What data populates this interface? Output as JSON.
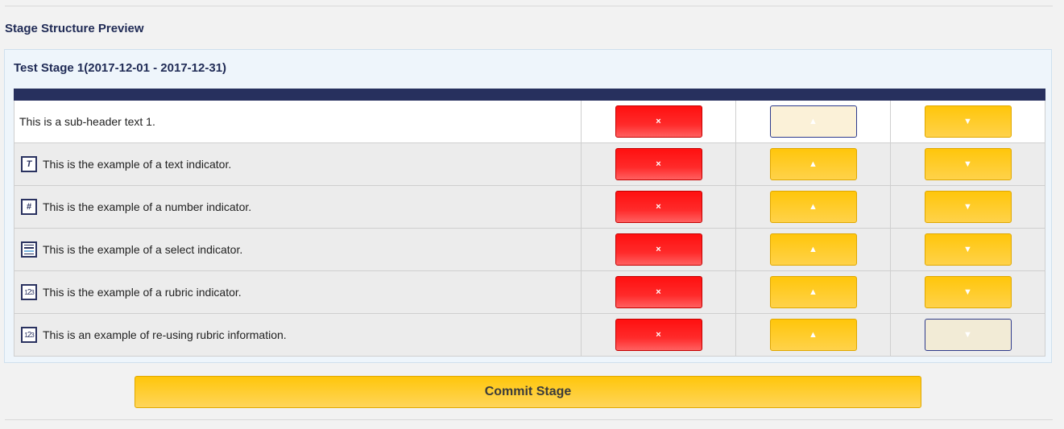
{
  "section_title": "Stage Structure Preview",
  "stage": {
    "title": "Test Stage 1(2017-12-01 - 2017-12-31)"
  },
  "rows": [
    {
      "label": "This is a sub-header text 1.",
      "type": "subheader",
      "icon": null,
      "up_disabled": true,
      "down_disabled": false
    },
    {
      "label": "This is the example of a text indicator.",
      "type": "text",
      "icon": "T",
      "up_disabled": false,
      "down_disabled": false
    },
    {
      "label": "This is the example of a number indicator.",
      "type": "number",
      "icon": "#",
      "up_disabled": false,
      "down_disabled": false
    },
    {
      "label": "This is the example of a select indicator.",
      "type": "select",
      "icon": "select-list-icon",
      "up_disabled": false,
      "down_disabled": false
    },
    {
      "label": "This is the example of a rubric indicator.",
      "type": "rubric",
      "icon": "123",
      "up_disabled": false,
      "down_disabled": false
    },
    {
      "label": "This is an example of re-using rubric information.",
      "type": "rubric",
      "icon": "123",
      "up_disabled": false,
      "down_disabled": true
    }
  ],
  "buttons": {
    "remove_glyph": "×",
    "up_glyph": "▲",
    "down_glyph": "▼",
    "commit_label": "Commit Stage"
  },
  "colors": {
    "header_navy": "#27305e",
    "remove_red": "#ff1a1a",
    "move_yellow": "#ffc60b"
  }
}
